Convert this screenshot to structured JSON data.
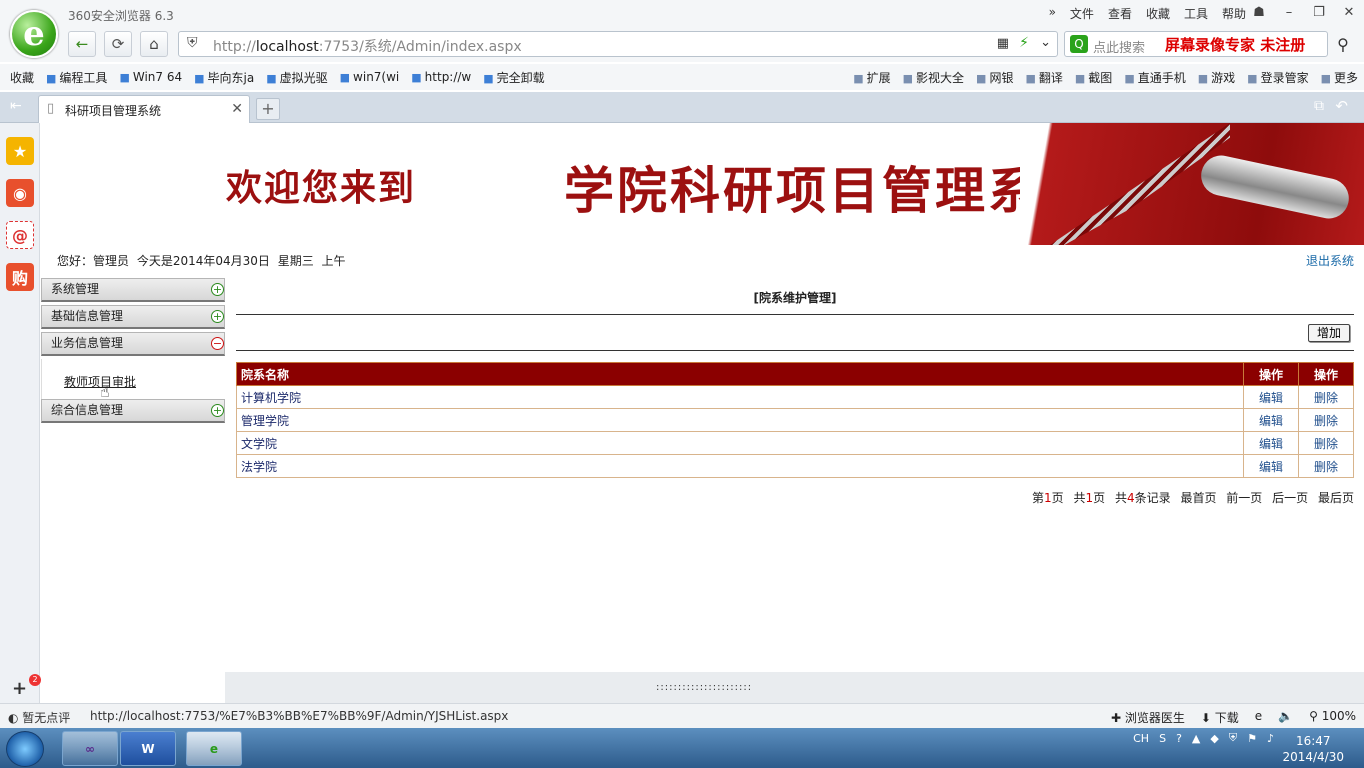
{
  "browser": {
    "title": "360安全浏览器 6.3",
    "menu": [
      "文件",
      "查看",
      "收藏",
      "工具",
      "帮助"
    ],
    "address_prefix": "http://",
    "address_host": "localhost",
    "address_rest": ":7753/系统/Admin/index.aspx",
    "search_placeholder": "点此搜索",
    "recorder_watermark": "屏幕录像专家  未注册",
    "bookmarks": [
      "收藏",
      "编程工具",
      "Win7 64",
      "毕向东ja",
      "虚拟光驱",
      "win7(wi",
      "http://w",
      "完全卸载"
    ],
    "bookmarks_right": [
      "扩展",
      "影视大全",
      "网银",
      "翻译",
      "截图",
      "直通手机",
      "游戏",
      "登录管家",
      "更多"
    ],
    "tab_title": "科研项目管理系统"
  },
  "banner": {
    "welcome": "欢迎您来到",
    "system_title": "学院科研项目管理系统"
  },
  "info": {
    "greeting": "您好：管理员    今天是2014年04月30日    星期三    上午",
    "logout": "退出系统"
  },
  "menu": {
    "items": [
      {
        "label": "系统管理",
        "state": "+"
      },
      {
        "label": "基础信息管理",
        "state": "+"
      },
      {
        "label": "业务信息管理",
        "state": "−"
      },
      {
        "label": "综合信息管理",
        "state": "+"
      }
    ],
    "sub_item": "教师项目审批"
  },
  "panel": {
    "title": "[院系维护管理]",
    "add_button": "增加",
    "columns": [
      "院系名称",
      "操作",
      "操作"
    ],
    "rows": [
      {
        "name": "计算机学院",
        "edit": "编辑",
        "delete": "删除"
      },
      {
        "name": "管理学院",
        "edit": "编辑",
        "delete": "删除"
      },
      {
        "name": "文学院",
        "edit": "编辑",
        "delete": "删除"
      },
      {
        "name": "法学院",
        "edit": "编辑",
        "delete": "删除"
      }
    ],
    "pager": {
      "p1": "第",
      "cur": "1",
      "p2": "页",
      "t1": "共",
      "total": "1",
      "t2": "页",
      "r1": "共",
      "records": "4",
      "r2": "条记录",
      "first": "最首页",
      "prev": "前一页",
      "next": "后一页",
      "last": "最后页"
    }
  },
  "splitter": "::::::::::::::::::::::",
  "status": {
    "left": "暂无点评",
    "url": "http://localhost:7753/%E7%B3%BB%E7%BB%9F/Admin/YJSHList.aspx",
    "right": [
      "浏览器医生",
      "下载",
      "100%"
    ]
  },
  "taskbar": {
    "lang": "CH",
    "time": "16:47",
    "date": "2014/4/30",
    "badge": "2"
  }
}
